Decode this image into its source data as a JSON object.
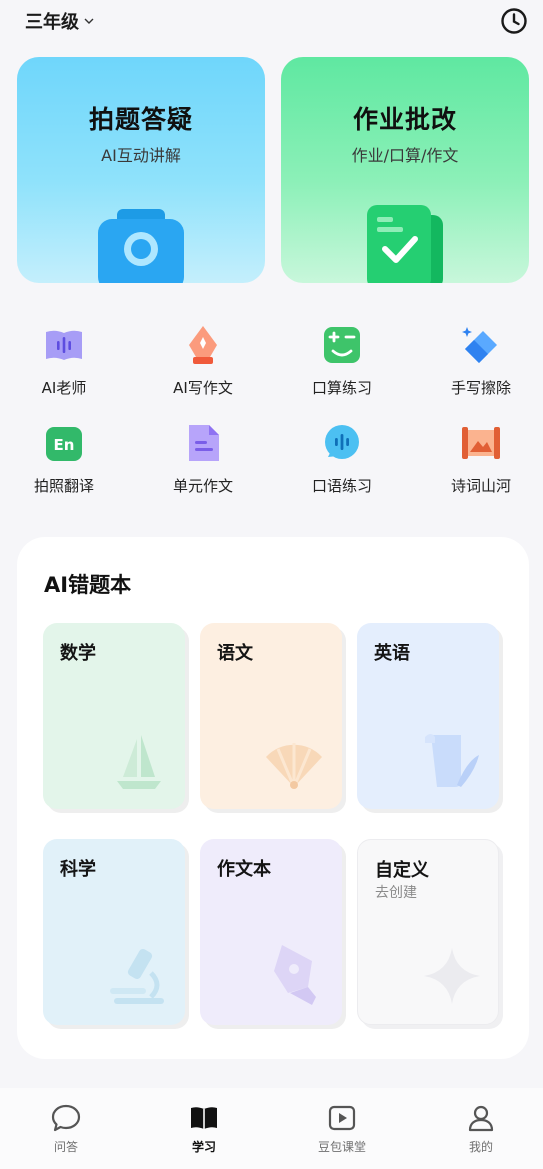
{
  "header": {
    "grade": "三年级",
    "grade_icon": "chevron-down-icon",
    "history_icon": "clock-icon"
  },
  "hero_cards": [
    {
      "title": "拍题答疑",
      "subtitle": "AI互动讲解",
      "icon": "camera-icon",
      "color": "#6fd6fb"
    },
    {
      "title": "作业批改",
      "subtitle": "作业/口算/作文",
      "icon": "check-document-icon",
      "color": "#5fe8a1"
    }
  ],
  "tools": [
    {
      "label": "AI老师",
      "icon": "ai-book-icon",
      "color": "#8a7cf0"
    },
    {
      "label": "AI写作文",
      "icon": "pen-nib-icon",
      "color": "#f26a4a"
    },
    {
      "label": "口算练习",
      "icon": "calculator-face-icon",
      "color": "#3ec46a"
    },
    {
      "label": "手写擦除",
      "icon": "eraser-icon",
      "color": "#3f8ff5"
    },
    {
      "label": "拍照翻译",
      "icon": "translate-en-icon",
      "color": "#32b96a"
    },
    {
      "label": "单元作文",
      "icon": "document-icon",
      "color": "#9a7ff5"
    },
    {
      "label": "口语练习",
      "icon": "speech-bubble-icon",
      "color": "#35b6f0"
    },
    {
      "label": "诗词山河",
      "icon": "scroll-landscape-icon",
      "color": "#f07a4a"
    }
  ],
  "mistake_book": {
    "title": "AI错题本",
    "subjects": [
      {
        "name": "数学",
        "subtitle": "",
        "icon": "sailboat-icon",
        "color": "#e3f5ea"
      },
      {
        "name": "语文",
        "subtitle": "",
        "icon": "fan-icon",
        "color": "#fdefe1"
      },
      {
        "name": "英语",
        "subtitle": "",
        "icon": "quill-scroll-icon",
        "color": "#e4eefd"
      },
      {
        "name": "科学",
        "subtitle": "",
        "icon": "microscope-icon",
        "color": "#e1f1f9"
      },
      {
        "name": "作文本",
        "subtitle": "",
        "icon": "fountain-pen-icon",
        "color": "#efecfb"
      },
      {
        "name": "自定义",
        "subtitle": "去创建",
        "icon": "sparkle-icon",
        "color": "#f8f8f9"
      }
    ]
  },
  "tabbar": [
    {
      "label": "问答",
      "icon": "chat-bubble-icon",
      "active": false
    },
    {
      "label": "学习",
      "icon": "open-book-icon",
      "active": true
    },
    {
      "label": "豆包课堂",
      "icon": "play-video-icon",
      "active": false
    },
    {
      "label": "我的",
      "icon": "person-icon",
      "active": false
    }
  ]
}
